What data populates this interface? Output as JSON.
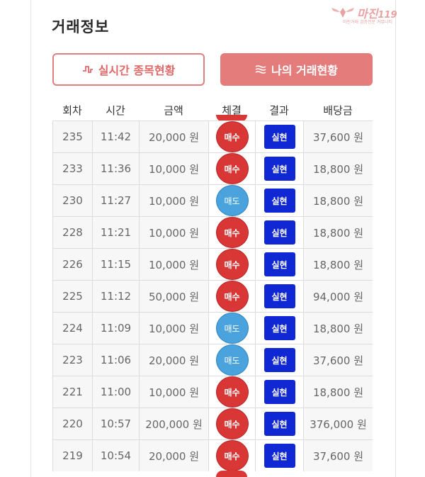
{
  "page": {
    "title": "거래정보"
  },
  "watermark": {
    "brand": "마진",
    "brand_suffix": "119",
    "tagline": "마진거래 검증전문 커뮤니티"
  },
  "tabs": [
    {
      "label": "실시간 종목현황",
      "icon": "pulse-icon",
      "active": false
    },
    {
      "label": "나의 거래현황",
      "icon": "wave-lines-icon",
      "active": true
    }
  ],
  "table": {
    "headers": [
      "회차",
      "시간",
      "금액",
      "체결",
      "결과",
      "배당금"
    ],
    "rows": [
      {
        "round": "235",
        "time": "11:42",
        "amount": "20,000 원",
        "trade": "매수",
        "trade_type": "buy",
        "result": "실현",
        "payout": "37,600 원"
      },
      {
        "round": "233",
        "time": "11:36",
        "amount": "10,000 원",
        "trade": "매수",
        "trade_type": "buy",
        "result": "실현",
        "payout": "18,800 원"
      },
      {
        "round": "230",
        "time": "11:27",
        "amount": "10,000 원",
        "trade": "매도",
        "trade_type": "sell",
        "result": "실현",
        "payout": "18,800 원"
      },
      {
        "round": "228",
        "time": "11:21",
        "amount": "10,000 원",
        "trade": "매수",
        "trade_type": "buy",
        "result": "실현",
        "payout": "18,800 원"
      },
      {
        "round": "226",
        "time": "11:15",
        "amount": "10,000 원",
        "trade": "매수",
        "trade_type": "buy",
        "result": "실현",
        "payout": "18,800 원"
      },
      {
        "round": "225",
        "time": "11:12",
        "amount": "50,000 원",
        "trade": "매수",
        "trade_type": "buy",
        "result": "실현",
        "payout": "94,000 원"
      },
      {
        "round": "224",
        "time": "11:09",
        "amount": "10,000 원",
        "trade": "매도",
        "trade_type": "sell",
        "result": "실현",
        "payout": "18,800 원"
      },
      {
        "round": "223",
        "time": "11:06",
        "amount": "20,000 원",
        "trade": "매도",
        "trade_type": "sell",
        "result": "실현",
        "payout": "37,600 원"
      },
      {
        "round": "221",
        "time": "11:00",
        "amount": "10,000 원",
        "trade": "매수",
        "trade_type": "buy",
        "result": "실현",
        "payout": "18,800 원"
      },
      {
        "round": "220",
        "time": "10:57",
        "amount": "200,000 원",
        "trade": "매수",
        "trade_type": "buy",
        "result": "실현",
        "payout": "376,000 원"
      },
      {
        "round": "219",
        "time": "10:54",
        "amount": "20,000 원",
        "trade": "매수",
        "trade_type": "buy",
        "result": "실현",
        "payout": "37,600 원"
      }
    ]
  },
  "colors": {
    "buy": "#d93636",
    "sell": "#4aa3dc",
    "result": "#1028d4",
    "accent": "#e57c7c"
  }
}
